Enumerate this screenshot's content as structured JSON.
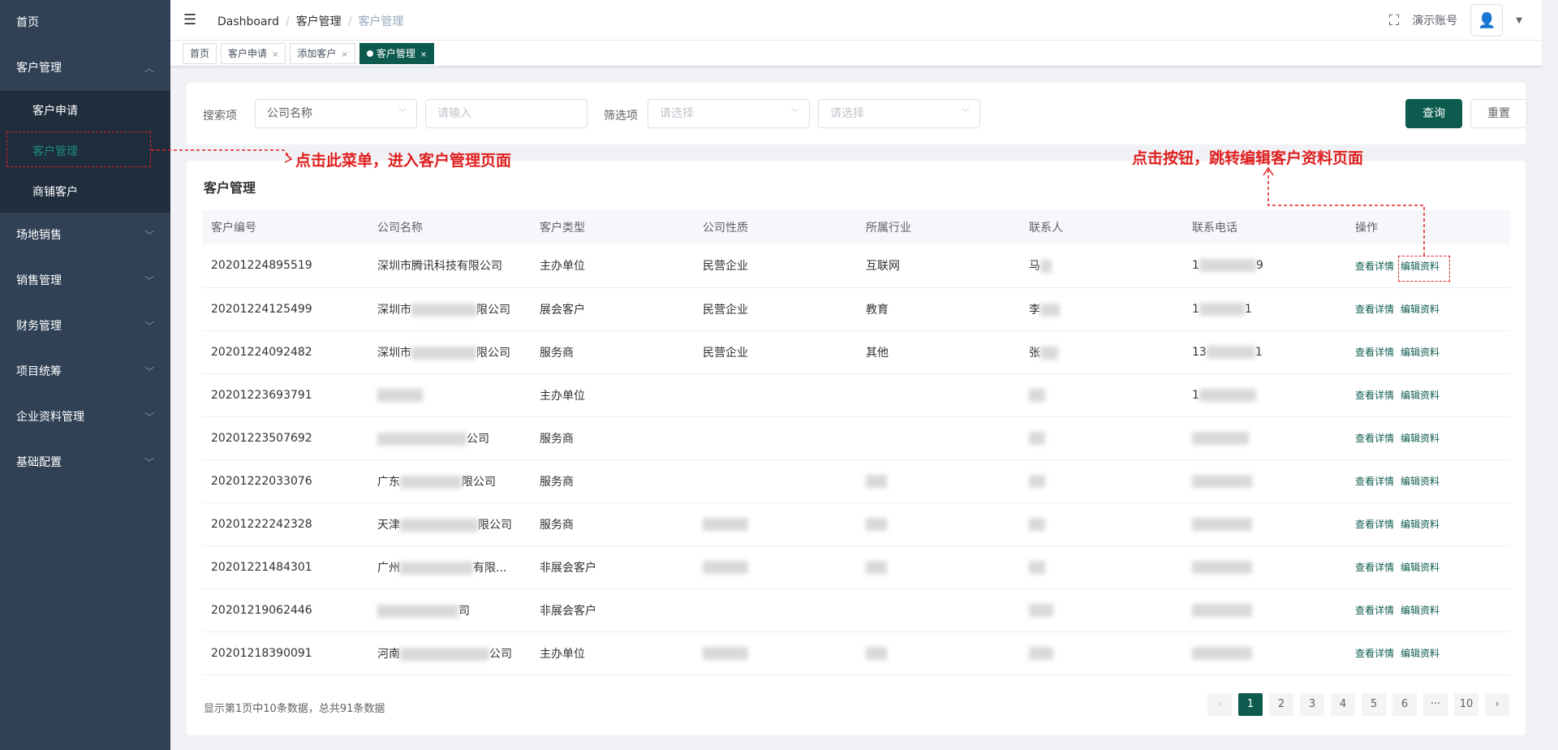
{
  "sidebar": {
    "home": "首页",
    "customer_mgmt": "客户管理",
    "sub": [
      {
        "label": "客户申请"
      },
      {
        "label": "客户管理"
      },
      {
        "label": "商铺客户"
      }
    ],
    "groups": [
      "场地销售",
      "销售管理",
      "财务管理",
      "项目统筹",
      "企业资料管理",
      "基础配置"
    ]
  },
  "navbar": {
    "breadcrumb": [
      "Dashboard",
      "客户管理",
      "客户管理"
    ],
    "user": "演示账号"
  },
  "tags": [
    {
      "label": "首页"
    },
    {
      "label": "客户申请"
    },
    {
      "label": "添加客户"
    },
    {
      "label": "客户管理"
    }
  ],
  "search": {
    "label_search": "搜索项",
    "search_field": "公司名称",
    "input_placeholder": "请输入",
    "label_filter": "筛选项",
    "filter1_placeholder": "请选择",
    "filter2_placeholder": "请选择",
    "query": "查询",
    "reset": "重置"
  },
  "table": {
    "title": "客户管理",
    "headers": [
      "客户编号",
      "公司名称",
      "客户类型",
      "公司性质",
      "所属行业",
      "联系人",
      "联系电话",
      "操作"
    ],
    "rows": [
      {
        "id": "20201224895519",
        "company": "深圳市腾讯科技有限公司",
        "type": "主办单位",
        "nature": "民营企业",
        "industry": "互联网",
        "contact": "马",
        "phone": "1",
        "phone_tail": "9"
      },
      {
        "id": "20201224125499",
        "company": "深圳市",
        "company_tail": "限公司",
        "type": "展会客户",
        "nature": "民营企业",
        "industry": "教育",
        "contact": "李",
        "phone": "1",
        "phone_tail": "1"
      },
      {
        "id": "20201224092482",
        "company": "深圳市",
        "company_tail": "限公司",
        "type": "服务商",
        "nature": "民营企业",
        "industry": "其他",
        "contact": "张",
        "phone": "13",
        "phone_tail": "1"
      },
      {
        "id": "20201223693791",
        "company": "",
        "type": "主办单位",
        "nature": "",
        "industry": "",
        "contact": "",
        "phone": "1"
      },
      {
        "id": "20201223507692",
        "company": "",
        "company_tail": "公司",
        "type": "服务商",
        "nature": "",
        "industry": "",
        "contact": "",
        "phone": ""
      },
      {
        "id": "20201222033076",
        "company": "广东",
        "company_tail": "限公司",
        "type": "服务商",
        "nature": "",
        "industry": "",
        "contact": "",
        "phone": ""
      },
      {
        "id": "20201222242328",
        "company": "天津",
        "company_tail": "限公司",
        "type": "服务商",
        "nature": "",
        "industry": "",
        "contact": "",
        "phone": ""
      },
      {
        "id": "20201221484301",
        "company": "广州",
        "company_tail": "有限...",
        "type": "非展会客户",
        "nature": "",
        "industry": "",
        "contact": "",
        "phone": ""
      },
      {
        "id": "20201219062446",
        "company": "",
        "company_tail": "司",
        "type": "非展会客户",
        "nature": "",
        "industry": "",
        "contact": "",
        "phone": ""
      },
      {
        "id": "20201218390091",
        "company": "河南",
        "company_tail": "公司",
        "type": "主办单位",
        "nature": "",
        "industry": "",
        "contact": "",
        "phone": ""
      }
    ],
    "op_view": "查看详情",
    "op_edit": "编辑资料"
  },
  "pagination": {
    "info": "显示第1页中10条数据，总共91条数据",
    "pages": [
      "1",
      "2",
      "3",
      "4",
      "5",
      "6",
      "···",
      "10"
    ],
    "current_page": 1
  },
  "annotations": {
    "menu_hint": "点击此菜单，进入客户管理页面",
    "button_hint": "点击按钮，跳转编辑客户资料页面"
  },
  "colors": {
    "accent": "#0d5b4f",
    "sidebar": "#304156",
    "annotation": "#e02020"
  }
}
